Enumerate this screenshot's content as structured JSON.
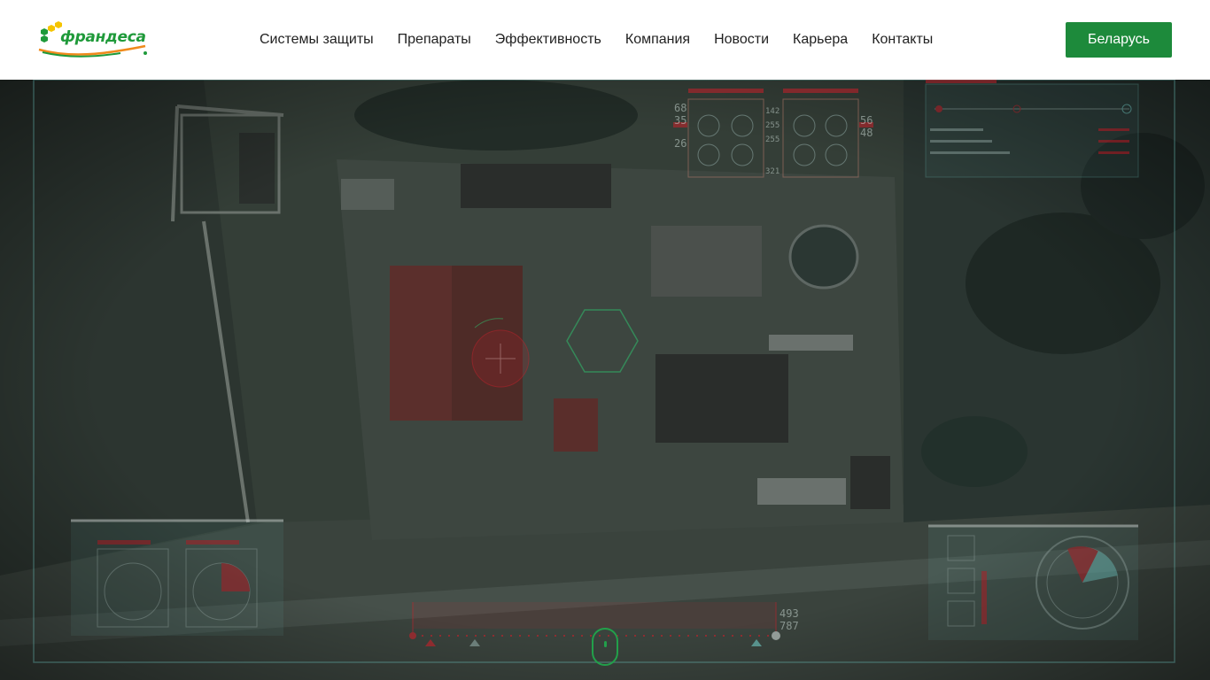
{
  "header": {
    "logo_text": "франдеса",
    "nav": [
      {
        "label": "Системы защиты"
      },
      {
        "label": "Препараты"
      },
      {
        "label": "Эффективность"
      },
      {
        "label": "Компания"
      },
      {
        "label": "Новости"
      },
      {
        "label": "Карьера"
      },
      {
        "label": "Контакты"
      }
    ],
    "region_button": "Беларусь"
  },
  "hero": {
    "hud_top_left_numbers": [
      "68",
      "35",
      "26"
    ],
    "hud_top_mid_numbers": [
      "142",
      "255",
      "255",
      "321"
    ],
    "hud_top_right_numbers": [
      "56",
      "48"
    ],
    "hud_bottom_numbers": [
      "493",
      "787"
    ]
  },
  "colors": {
    "brand_green": "#1d8a3b",
    "scroll_indicator": "#22a04a",
    "hud_red": "#c8202a",
    "hud_cyan": "#6fc9c4"
  }
}
